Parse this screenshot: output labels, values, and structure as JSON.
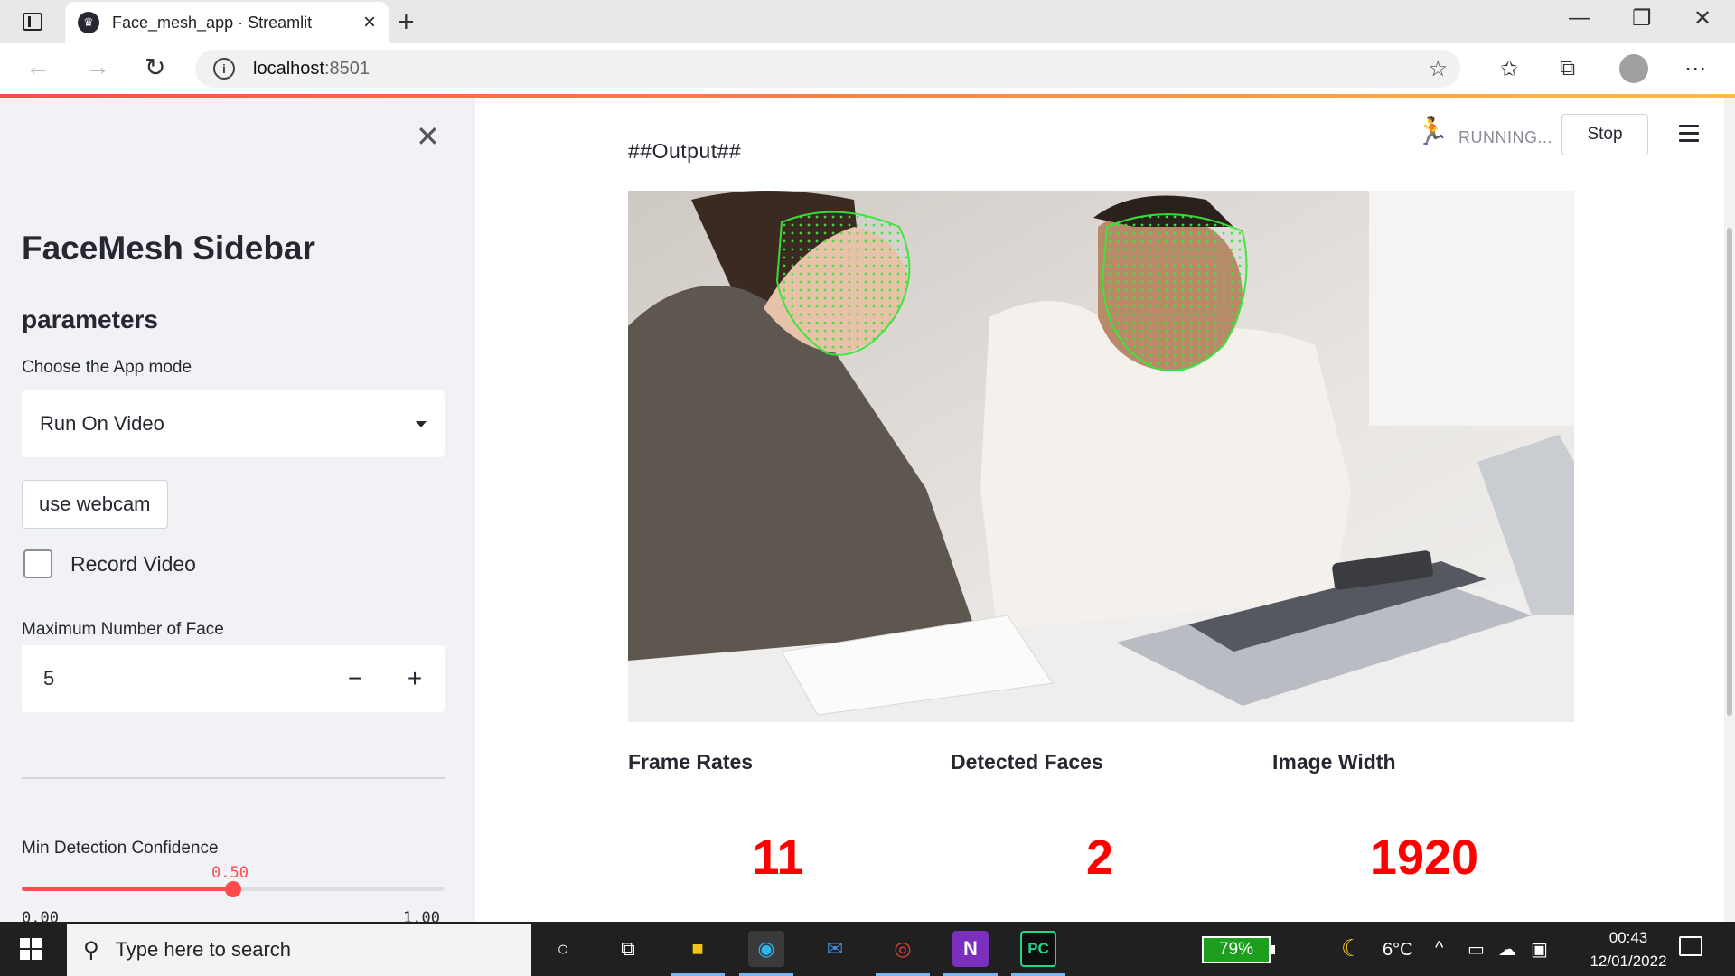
{
  "browser": {
    "tab_title": "Face_mesh_app · Streamlit",
    "url_host": "localhost",
    "url_port": ":8501"
  },
  "sidebar": {
    "title": "FaceMesh Sidebar",
    "subtitle": "parameters",
    "mode_label": "Choose the App mode",
    "mode_value": "Run On Video",
    "webcam_label": "use webcam",
    "record_label": "Record Video",
    "record_checked": false,
    "max_faces_label": "Maximum Number of Face",
    "max_faces_value": "5",
    "min_conf_label": "Min Detection Confidence",
    "min_conf_value": "0.50",
    "min_conf_fraction": 0.5,
    "min_conf_min": "0.00",
    "min_conf_max": "1.00"
  },
  "main": {
    "status": "RUNNING...",
    "stop_label": "Stop",
    "output_heading": "##Output##",
    "metrics": [
      {
        "label": "Frame Rates",
        "value": "11"
      },
      {
        "label": "Detected Faces",
        "value": "2"
      },
      {
        "label": "Image Width",
        "value": "1920"
      }
    ]
  },
  "taskbar": {
    "search_placeholder": "Type here to search",
    "battery": "79%",
    "weather": "6°C",
    "time": "00:43",
    "date": "12/01/2022"
  },
  "colors": {
    "accent": "#ff4b4b",
    "metric_value": "#ff0000",
    "mesh": "#39e639"
  }
}
